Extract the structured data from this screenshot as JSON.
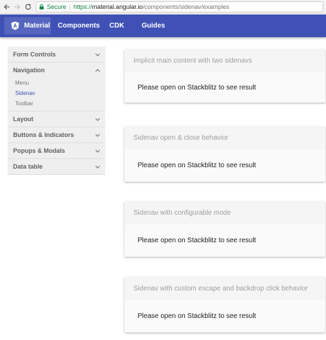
{
  "browser": {
    "back_icon": "back-arrow-icon",
    "forward_icon": "forward-arrow-icon",
    "reload_icon": "reload-icon",
    "secure_label": "Secure",
    "url_scheme": "https://",
    "url_host": "material.angular.io",
    "url_path": "/components/sidenav/examples"
  },
  "toolbar": {
    "home_label": "Material",
    "links": [
      "Components",
      "CDK",
      "Guides"
    ],
    "color": "#3f51b5"
  },
  "sidenav": {
    "groups": [
      {
        "label": "Form Controls",
        "expanded": false
      },
      {
        "label": "Navigation",
        "expanded": true,
        "items": [
          "Menu",
          "Sidenav",
          "Toolbar"
        ],
        "active": "Sidenav"
      },
      {
        "label": "Layout",
        "expanded": false
      },
      {
        "label": "Buttons & Indicators",
        "expanded": false
      },
      {
        "label": "Popups & Modals",
        "expanded": false
      },
      {
        "label": "Data table",
        "expanded": false
      }
    ]
  },
  "examples": [
    {
      "title": "Implicit main content with two sidenavs",
      "body": "Please open on Stackblitz to see result"
    },
    {
      "title": "Sidenav open & close behavior",
      "body": "Please open on Stackblitz to see result"
    },
    {
      "title": "Sidenav with configurable mode",
      "body": "Please open on Stackblitz to see result"
    },
    {
      "title": "Sidenav with custom escape and backdrop click behavior",
      "body": "Please open on Stackblitz to see result"
    }
  ]
}
